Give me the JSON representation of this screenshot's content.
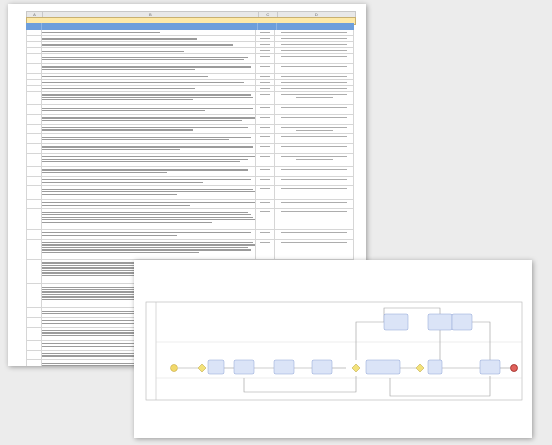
{
  "sheet_page": {
    "column_letters": [
      "A",
      "B",
      "C",
      "D"
    ],
    "title": "",
    "headers": [
      "",
      "",
      "",
      ""
    ],
    "rows": [
      {
        "lines": 1,
        "req": "",
        "resp": 1
      },
      {
        "lines": 1,
        "req": "",
        "resp": 1
      },
      {
        "lines": 1,
        "req": "",
        "resp": 1
      },
      {
        "lines": 1,
        "req": "",
        "resp": 1
      },
      {
        "lines": 2,
        "req": "",
        "resp": 1
      },
      {
        "lines": 2,
        "req": "",
        "resp": 1
      },
      {
        "lines": 1,
        "req": "",
        "resp": 1
      },
      {
        "lines": 1,
        "req": "",
        "resp": 1
      },
      {
        "lines": 1,
        "req": "",
        "resp": 1
      },
      {
        "lines": 3,
        "req": "",
        "resp": 2
      },
      {
        "lines": 2,
        "req": "",
        "resp": 1
      },
      {
        "lines": 2,
        "req": "",
        "resp": 1
      },
      {
        "lines": 2,
        "req": "",
        "resp": 2
      },
      {
        "lines": 2,
        "req": "",
        "resp": 1
      },
      {
        "lines": 2,
        "req": "",
        "resp": 1
      },
      {
        "lines": 3,
        "req": "",
        "resp": 2
      },
      {
        "lines": 2,
        "req": "",
        "resp": 1
      },
      {
        "lines": 2,
        "req": "",
        "resp": 1
      },
      {
        "lines": 3,
        "req": "",
        "resp": 1
      },
      {
        "lines": 2,
        "req": "",
        "resp": 1
      },
      {
        "lines": 5,
        "req": "",
        "resp": 1
      },
      {
        "lines": 2,
        "req": "",
        "resp": 1
      },
      {
        "lines": 5,
        "req": "",
        "resp": 1
      },
      {
        "lines": 6,
        "req": "",
        "resp": 1
      },
      {
        "lines": 6,
        "req": "",
        "resp": 1
      },
      {
        "lines": 2,
        "req": "",
        "resp": 1
      },
      {
        "lines": 2,
        "req": "",
        "resp": 1
      },
      {
        "lines": 3,
        "req": "",
        "resp": 1
      },
      {
        "lines": 2,
        "req": "",
        "resp": 1
      },
      {
        "lines": 2,
        "req": "",
        "resp": 1
      },
      {
        "lines": 2,
        "req": "",
        "resp": 2
      },
      {
        "lines": 1,
        "req": "",
        "resp": 1
      },
      {
        "lines": 1,
        "req": "",
        "resp": 1
      }
    ]
  },
  "diagram_page": {
    "colors": {
      "task": "#dbe4f7",
      "task_border": "#8da2d6",
      "start": "#f2d96b",
      "end": "#e0625c",
      "gateway": "#f3e27a",
      "line": "#9a9a9a"
    }
  }
}
